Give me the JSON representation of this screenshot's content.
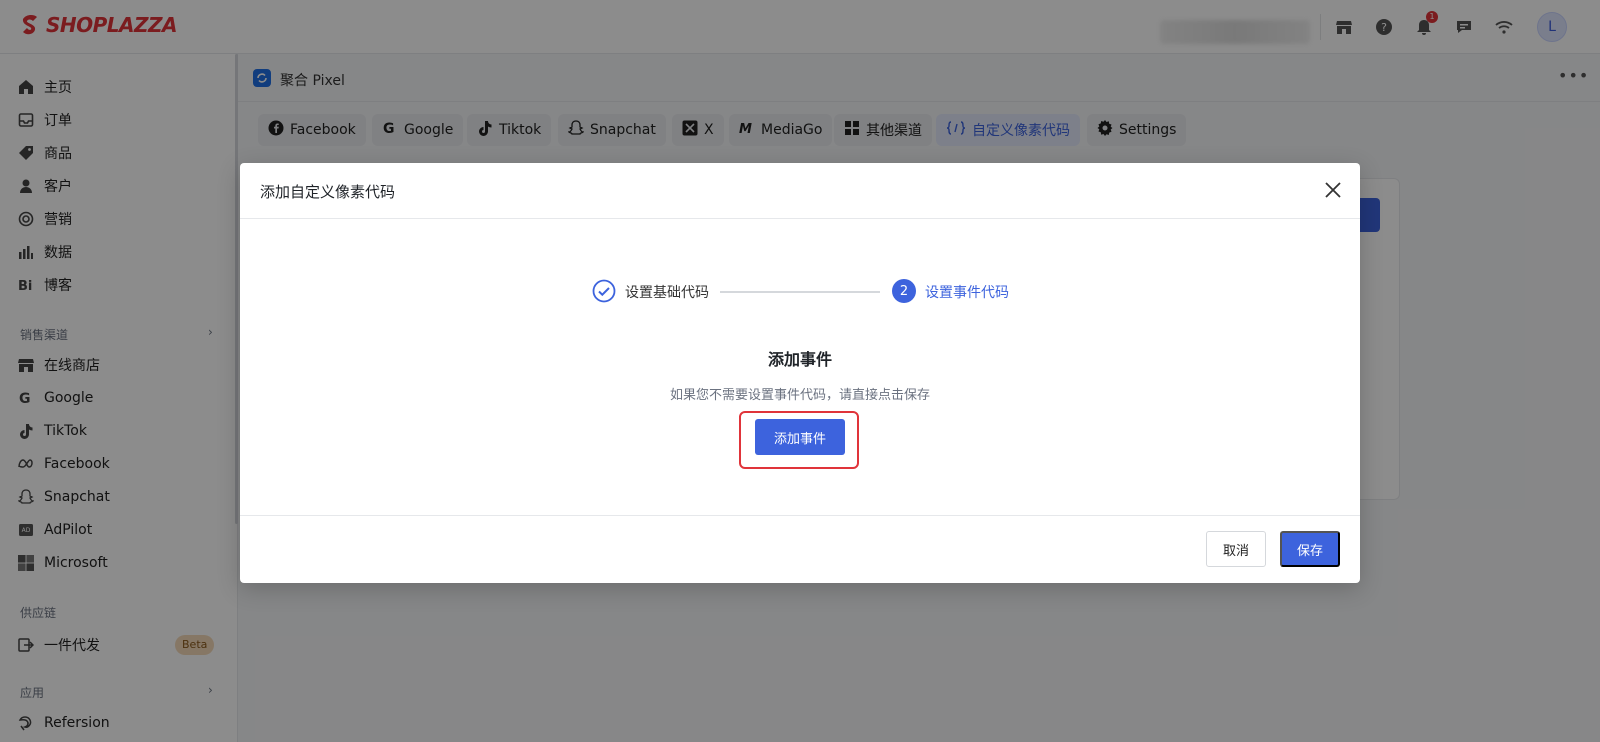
{
  "brand": {
    "name": "SHOPLAZZA",
    "color": "#e0343a"
  },
  "topbar": {
    "icons": [
      "store-icon",
      "help-icon",
      "bell-icon",
      "chat-icon",
      "wifi-icon"
    ],
    "notification_count": "1",
    "avatar_initial": "L"
  },
  "sidebar": {
    "items": [
      {
        "label": "主页",
        "icon": "home-icon"
      },
      {
        "label": "订单",
        "icon": "inbox-icon"
      },
      {
        "label": "商品",
        "icon": "tag-icon"
      },
      {
        "label": "客户",
        "icon": "user-icon"
      },
      {
        "label": "营销",
        "icon": "target-icon"
      },
      {
        "label": "数据",
        "icon": "bar-chart-icon"
      },
      {
        "label": "博客",
        "icon": "blog-icon"
      }
    ],
    "sales_channels_title": "销售渠道",
    "channels": [
      {
        "label": "在线商店",
        "icon": "store-icon"
      },
      {
        "label": "Google",
        "icon": "google-icon"
      },
      {
        "label": "TikTok",
        "icon": "tiktok-icon"
      },
      {
        "label": "Facebook",
        "icon": "meta-icon"
      },
      {
        "label": "Snapchat",
        "icon": "snapchat-icon"
      },
      {
        "label": "AdPilot",
        "icon": "adpilot-icon"
      },
      {
        "label": "Microsoft",
        "icon": "microsoft-icon"
      }
    ],
    "supply_title": "供应链",
    "supply_item": {
      "label": "一件代发",
      "badge": "Beta"
    },
    "apps_title": "应用",
    "apps_item": {
      "label": "Refersion"
    }
  },
  "main": {
    "app_title": "聚合 Pixel",
    "tabs": [
      {
        "label": "Facebook",
        "icon": "facebook-icon"
      },
      {
        "label": "Google",
        "icon": "google-icon"
      },
      {
        "label": "Tiktok",
        "icon": "tiktok-icon"
      },
      {
        "label": "Snapchat",
        "icon": "snapchat-icon"
      },
      {
        "label": "X",
        "icon": "x-icon"
      },
      {
        "label": "MediaGo",
        "icon": "mediago-icon"
      },
      {
        "label": "其他渠道",
        "icon": "grid-icon"
      },
      {
        "label": "自定义像素代码",
        "icon": "code-icon",
        "active": true
      },
      {
        "label": "Settings",
        "icon": "gear-icon"
      }
    ]
  },
  "modal": {
    "title": "添加自定义像素代码",
    "steps": [
      {
        "label": "设置基础代码",
        "state": "done"
      },
      {
        "number": "2",
        "label": "设置事件代码",
        "state": "active"
      }
    ],
    "section_title": "添加事件",
    "section_desc": "如果您不需要设置事件代码，请直接点击保存",
    "add_event_label": "添加事件",
    "cancel_label": "取消",
    "save_label": "保存"
  },
  "colors": {
    "primary": "#3d63dd",
    "highlight": "#e0343a"
  }
}
